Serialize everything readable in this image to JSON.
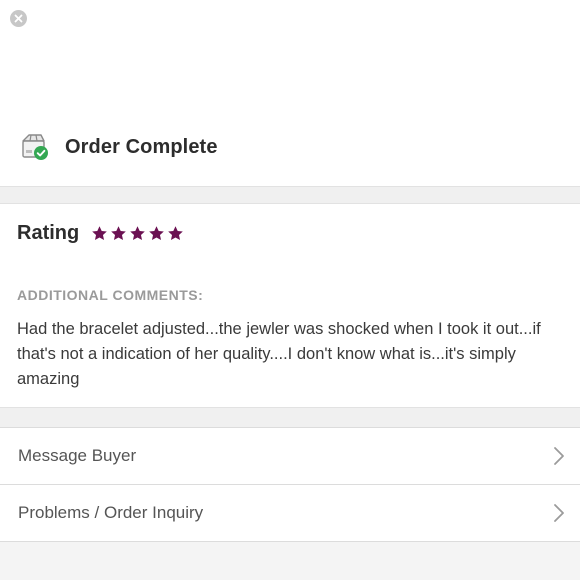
{
  "header": {
    "close_icon": "close-icon",
    "status_icon": "box-check-icon",
    "status_title": "Order Complete"
  },
  "review": {
    "rating_label": "Rating",
    "stars": 5,
    "star_color": "#6b1152",
    "comments_label": "ADDITIONAL COMMENTS:",
    "comments_text": "Had the bracelet adjusted...the jewler was shocked when I took it out...if that's not a indication of her quality....I don't know what is...it's simply amazing"
  },
  "menu": {
    "items": [
      {
        "label": "Message Buyer",
        "icon": "chevron-right-icon"
      },
      {
        "label": "Problems / Order Inquiry",
        "icon": "chevron-right-icon"
      }
    ]
  },
  "colors": {
    "accent_check": "#34a853",
    "text_primary": "#2d2d2d",
    "text_muted": "#9a9a9a"
  }
}
